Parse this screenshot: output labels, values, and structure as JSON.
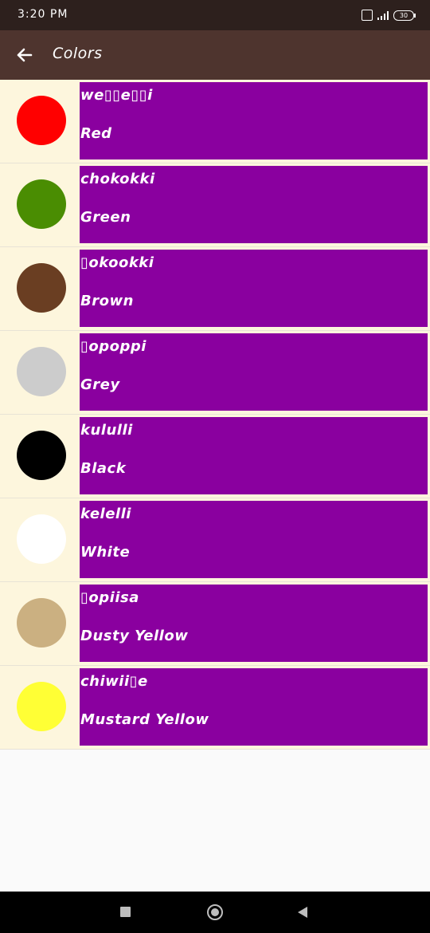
{
  "status_bar": {
    "time": "3:20 PM",
    "battery": "30"
  },
  "app_bar": {
    "title": "Colors"
  },
  "items": [
    {
      "native": "we▯▯e▯▯i",
      "english": "Red",
      "color": "#ff0000"
    },
    {
      "native": "chokokki",
      "english": "Green",
      "color": "#4a8d02"
    },
    {
      "native": "▯okookki",
      "english": "Brown",
      "color": "#6a3e22"
    },
    {
      "native": "▯opoppi",
      "english": "Grey",
      "color": "#cccccc"
    },
    {
      "native": "kululli",
      "english": "Black",
      "color": "#000000"
    },
    {
      "native": "kelelli",
      "english": "White",
      "color": "#ffffff"
    },
    {
      "native": "▯opiisa",
      "english": "Dusty Yellow",
      "color": "#cbb081"
    },
    {
      "native": "chiwii▯e",
      "english": "Mustard Yellow",
      "color": "#ffff35"
    }
  ]
}
